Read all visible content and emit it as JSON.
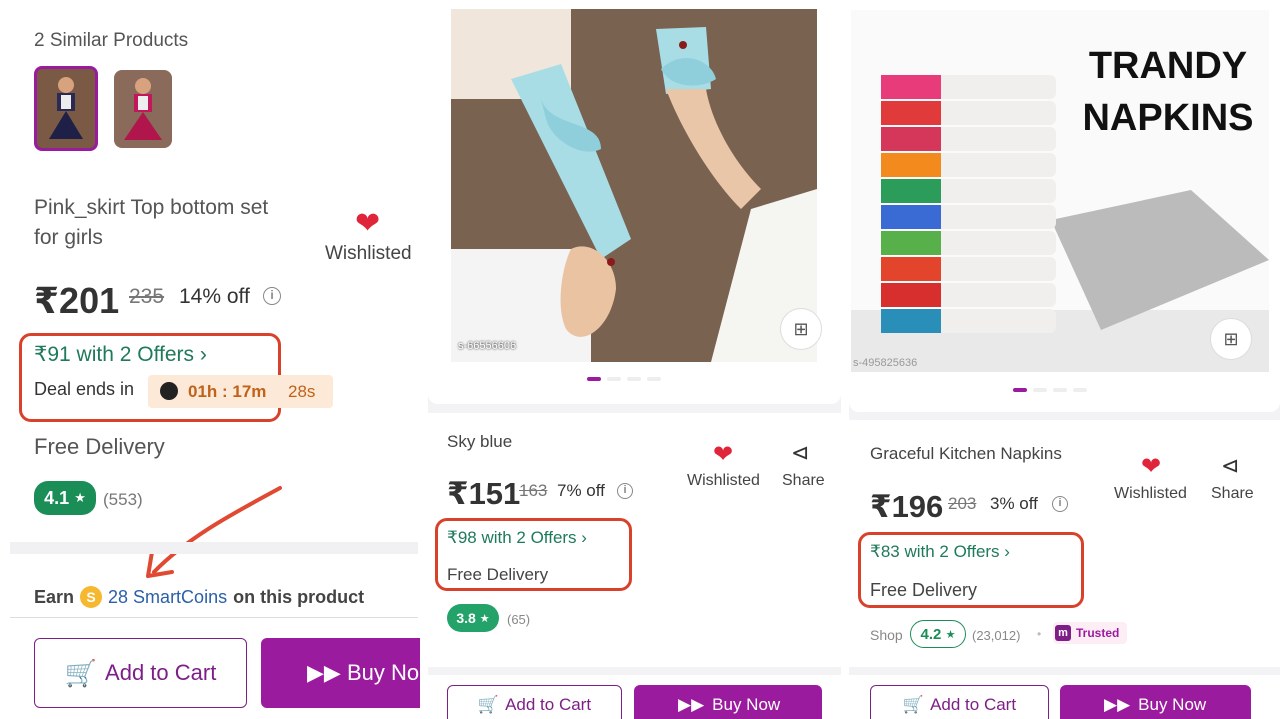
{
  "panel1": {
    "similar_label": "2 Similar Products",
    "title": "Pink_skirt Top bottom set for girls",
    "wishlisted": "Wishlisted",
    "price": "₹201",
    "mrp": "235",
    "discount": "14% off",
    "offers": "₹91 with 2 Offers",
    "deal_label": "Deal ends in",
    "timer": "01h : 17m",
    "timer_sec": "28s",
    "delivery": "Free Delivery",
    "rating": "4.1",
    "rating_count": "(553)",
    "earn_prefix": "Earn",
    "smartcoins": "28 SmartCoins",
    "earn_suffix": "on this product",
    "add_to_cart": "Add to Cart",
    "buy_now": "Buy No",
    "colors": {
      "accent": "#9b1b9e",
      "green": "#1f7a5a",
      "annotation": "#d9422a"
    }
  },
  "panel2": {
    "image_code": "s-66556606",
    "title": "Sky blue",
    "wishlisted": "Wishlisted",
    "share": "Share",
    "price": "₹151",
    "mrp": "163",
    "discount": "7% off",
    "offers": "₹98 with 2 Offers",
    "delivery": "Free Delivery",
    "rating": "3.8",
    "rating_count": "(65)",
    "add_to_cart": "Add to Cart",
    "buy_now": "Buy Now"
  },
  "panel3": {
    "image_title_line1": "TRANDY",
    "image_title_line2": "NAPKINS",
    "image_code": "s-495825636",
    "title": "Graceful Kitchen Napkins",
    "wishlisted": "Wishlisted",
    "share": "Share",
    "price": "₹196",
    "mrp": "203",
    "discount": "3% off",
    "offers": "₹83 with 2 Offers",
    "delivery": "Free Delivery",
    "shop_label": "Shop",
    "rating": "4.2",
    "rating_count": "(23,012)",
    "trusted": "Trusted",
    "add_to_cart": "Add to Cart",
    "buy_now": "Buy Now"
  }
}
